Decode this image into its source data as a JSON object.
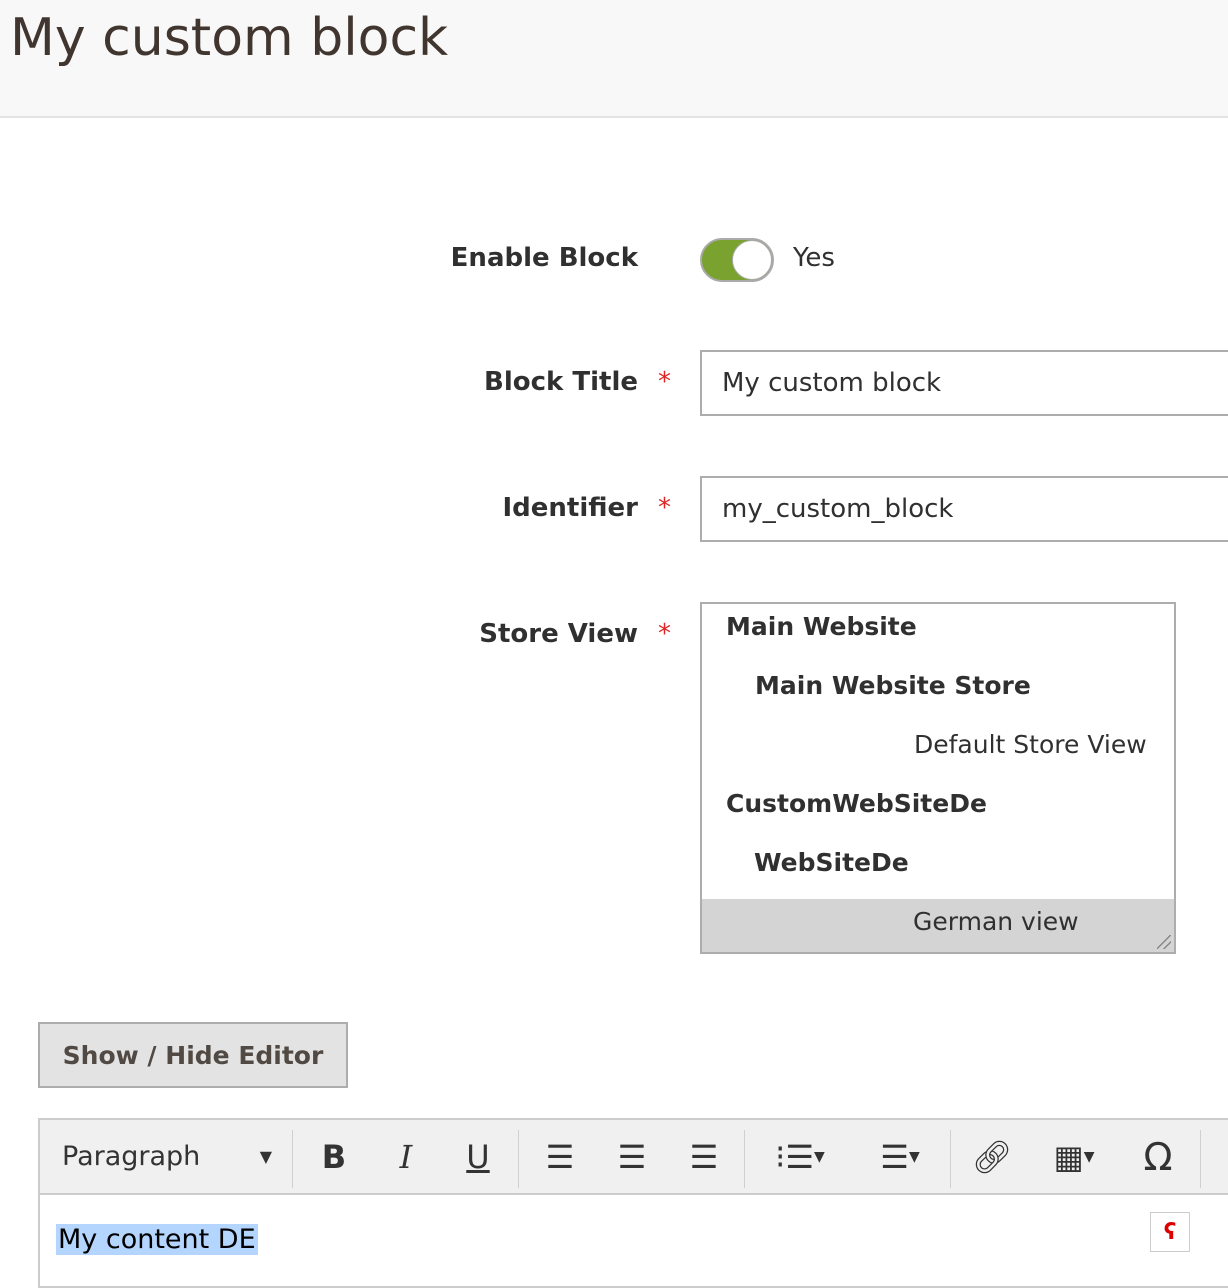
{
  "header": {
    "title": "My custom block"
  },
  "form": {
    "enable_label": "Enable Block",
    "enable_value": "Yes",
    "enabled": true,
    "title_label": "Block Title",
    "title_value": "My custom block",
    "identifier_label": "Identifier",
    "identifier_value": "my_custom_block",
    "store_label": "Store View",
    "required_mark": "*",
    "store_options": [
      "Main Website",
      "Main Website Store",
      "Default Store View",
      "CustomWebSiteDe",
      "WebSiteDe",
      "German view"
    ],
    "selected_store": "German view"
  },
  "editor": {
    "toggle_label": "Show / Hide Editor",
    "format": "Paragraph",
    "content": "My content DE"
  },
  "colors": {
    "toggle_on": "#79a22e",
    "required": "#e22626",
    "selection": "#b4d5fe"
  }
}
